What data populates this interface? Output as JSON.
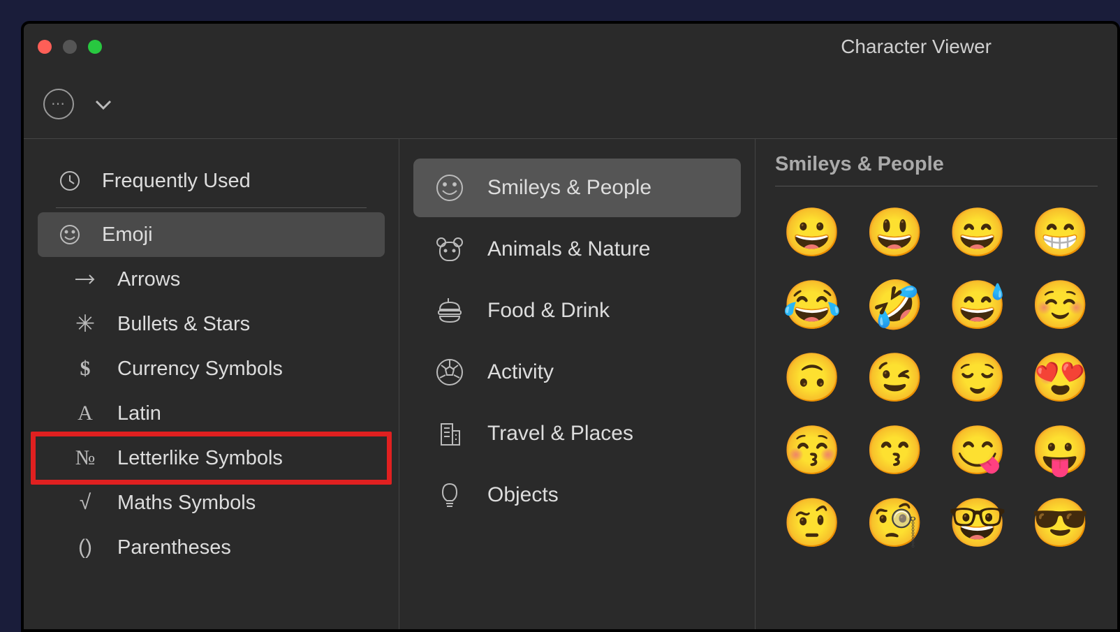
{
  "window": {
    "title": "Character Viewer"
  },
  "sidebar": {
    "items": [
      {
        "id": "frequently-used",
        "label": "Frequently Used",
        "icon": "clock"
      },
      {
        "id": "emoji",
        "label": "Emoji",
        "icon": "smiley",
        "selected": true
      },
      {
        "id": "arrows",
        "label": "Arrows",
        "icon": "arrow"
      },
      {
        "id": "bullets-stars",
        "label": "Bullets & Stars",
        "icon": "star"
      },
      {
        "id": "currency",
        "label": "Currency Symbols",
        "icon": "dollar"
      },
      {
        "id": "latin",
        "label": "Latin",
        "icon": "letter-a"
      },
      {
        "id": "letterlike",
        "label": "Letterlike Symbols",
        "icon": "numero",
        "highlighted": true
      },
      {
        "id": "maths",
        "label": "Maths Symbols",
        "icon": "sqrt"
      },
      {
        "id": "parentheses",
        "label": "Parentheses",
        "icon": "parens"
      }
    ]
  },
  "categories": {
    "items": [
      {
        "id": "smileys",
        "label": "Smileys & People",
        "icon": "smiley",
        "selected": true
      },
      {
        "id": "animals",
        "label": "Animals & Nature",
        "icon": "bear"
      },
      {
        "id": "food",
        "label": "Food & Drink",
        "icon": "burger"
      },
      {
        "id": "activity",
        "label": "Activity",
        "icon": "soccer"
      },
      {
        "id": "travel",
        "label": "Travel & Places",
        "icon": "building"
      },
      {
        "id": "objects",
        "label": "Objects",
        "icon": "bulb"
      }
    ]
  },
  "emoji_section": {
    "title": "Smileys & People",
    "emojis": [
      "😀",
      "😃",
      "😄",
      "😁",
      "😂",
      "🤣",
      "😅",
      "☺️",
      "🙃",
      "😉",
      "😌",
      "😍",
      "😚",
      "😙",
      "😋",
      "😛",
      "🤨",
      "🧐",
      "🤓",
      "😎"
    ]
  }
}
